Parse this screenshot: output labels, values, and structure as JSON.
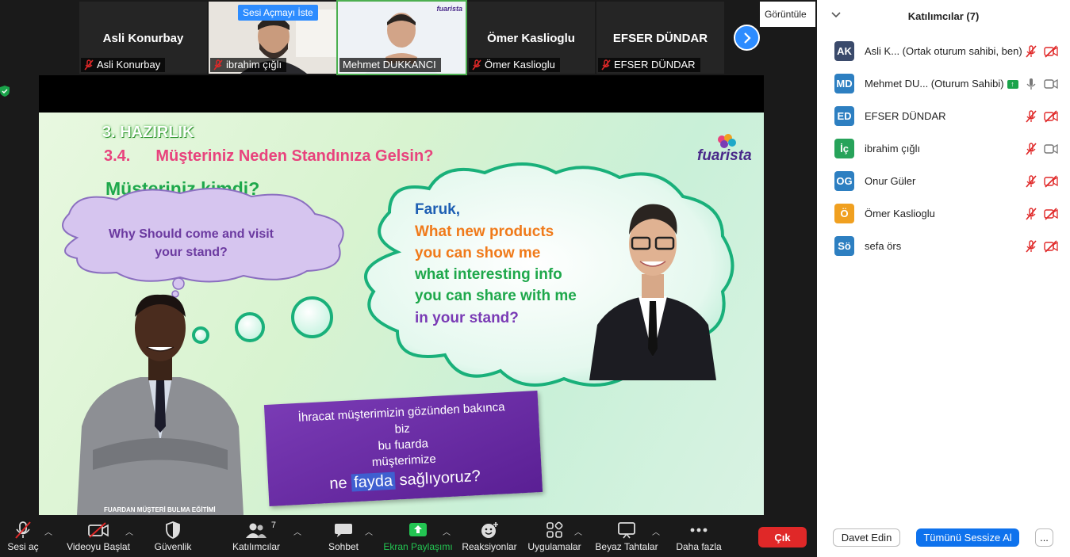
{
  "filmstrip": {
    "tiles": [
      {
        "name": "Asli Konurbay",
        "label": "Asli Konurbay"
      },
      {
        "label": "ibrahim çığlı",
        "badge": "Sesi Açmayı İste"
      },
      {
        "label": "Mehmet DUKKANCI",
        "logo": "fuarista"
      },
      {
        "name": "Ömer Kaslioglu",
        "label": "Ömer Kaslioglu"
      },
      {
        "name": "EFSER DÜNDAR",
        "label": "EFSER DÜNDAR"
      }
    ],
    "view_label": "Görüntüle",
    "next_icon": "chevron-right-icon"
  },
  "slide": {
    "heading": "3. HAZIRLIK",
    "section_num": "3.4.",
    "section_title": "Müşteriniz Neden Standınıza Gelsin?",
    "question": "Müşteriniz kimdi?",
    "left_cloud": [
      "Why Should come and visit",
      "your stand?"
    ],
    "right_cloud": [
      {
        "text": "Faruk,",
        "color": "#1e5fb3"
      },
      {
        "text": "What new products",
        "color": "#f07a1a"
      },
      {
        "text": "you can show me",
        "color": "#f07a1a"
      },
      {
        "text": "what interesting info",
        "color": "#1ea84b"
      },
      {
        "text": "you can share with me",
        "color": "#1ea84b"
      },
      {
        "text": "in your stand?",
        "color": "#7a3bb5"
      }
    ],
    "box_lines": [
      "İhracat müşterimizin gözünden bakınca",
      "biz",
      "bu fuarda",
      "müşterimize"
    ],
    "box_last": {
      "pre": "ne",
      "highlight": "fayda",
      "post": "sağlıyoruz?"
    },
    "logo": "fuarista",
    "footer": "FUARDAN MÜŞTERİ BULMA EĞİTİMİ"
  },
  "toolbar": {
    "items": [
      {
        "label": "Sesi aç",
        "icon": "mic-off-icon"
      },
      {
        "label": "Videoyu Başlat",
        "icon": "video-off-icon"
      },
      {
        "label": "Güvenlik",
        "icon": "shield-icon"
      },
      {
        "label": "Katılımcılar",
        "icon": "participants-icon",
        "count": "7"
      },
      {
        "label": "Sohbet",
        "icon": "chat-icon"
      },
      {
        "label": "Ekran Paylaşımı",
        "icon": "share-screen-icon"
      },
      {
        "label": "Reaksiyonlar",
        "icon": "reactions-icon"
      },
      {
        "label": "Uygulamalar",
        "icon": "apps-icon"
      },
      {
        "label": "Beyaz Tahtalar",
        "icon": "whiteboard-icon"
      },
      {
        "label": "Daha fazla",
        "icon": "more-icon"
      }
    ],
    "leave": "Çık"
  },
  "participants": {
    "title": "Katılımcılar (7)",
    "list": [
      {
        "initials": "AK",
        "color": "#3a4a6b",
        "name": "Asli K...  (Ortak oturum sahibi, ben)",
        "mic": "off",
        "video": "off"
      },
      {
        "initials": "MD",
        "color": "#2d7fc1",
        "name": "Mehmet DU...  (Oturum Sahibi)",
        "mic": "on",
        "video": "on",
        "host_icon": "share-up-icon"
      },
      {
        "initials": "ED",
        "color": "#2d7fc1",
        "name": "EFSER DÜNDAR",
        "mic": "off",
        "video": "off"
      },
      {
        "initials": "İç",
        "color": "#27a35a",
        "name": "ibrahim çığlı",
        "mic": "off",
        "video": "on"
      },
      {
        "initials": "OG",
        "color": "#2d7fc1",
        "name": "Onur Güler",
        "mic": "off",
        "video": "off"
      },
      {
        "initials": "Ö",
        "color": "#f0a020",
        "name": "Ömer Kaslioglu",
        "mic": "off",
        "video": "off"
      },
      {
        "initials": "Sö",
        "color": "#2d7fc1",
        "name": "sefa örs",
        "mic": "off",
        "video": "off"
      }
    ],
    "invite": "Davet Edin",
    "mute_all": "Tümünü Sessize Al",
    "more": "..."
  }
}
